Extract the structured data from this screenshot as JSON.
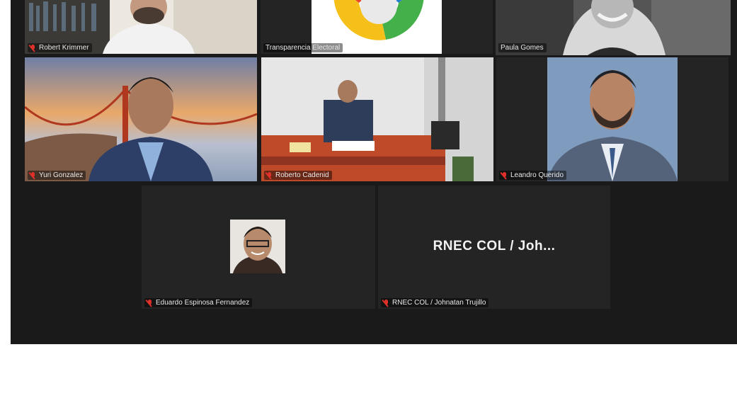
{
  "meeting": {
    "participants": [
      {
        "id": "robert",
        "name": "Robert Krimmer",
        "muted": true
      },
      {
        "id": "transparencia",
        "name": "Transparencia Electoral",
        "muted": false
      },
      {
        "id": "paula",
        "name": "Paula Gomes",
        "muted": false,
        "speaking": true
      },
      {
        "id": "yuri",
        "name": "Yuri Gonzalez",
        "muted": true
      },
      {
        "id": "roberto",
        "name": "Roberto Cadenid",
        "muted": true
      },
      {
        "id": "leandro",
        "name": "Leandro Querido",
        "muted": true
      },
      {
        "id": "eduardo",
        "name": "Eduardo Espinosa Fernandez",
        "muted": true
      },
      {
        "id": "rnec",
        "name": "RNEC COL / Johnatan Trujillo",
        "muted": true,
        "display_name": "RNEC COL / Joh..."
      }
    ]
  },
  "colors": {
    "speaker_outline": "#c8d64a",
    "muted_mic": "#e0302a",
    "tile_background": "#242424",
    "stage_background": "#1a1a1a"
  },
  "icons": {
    "muted": "mic-muted-icon"
  }
}
